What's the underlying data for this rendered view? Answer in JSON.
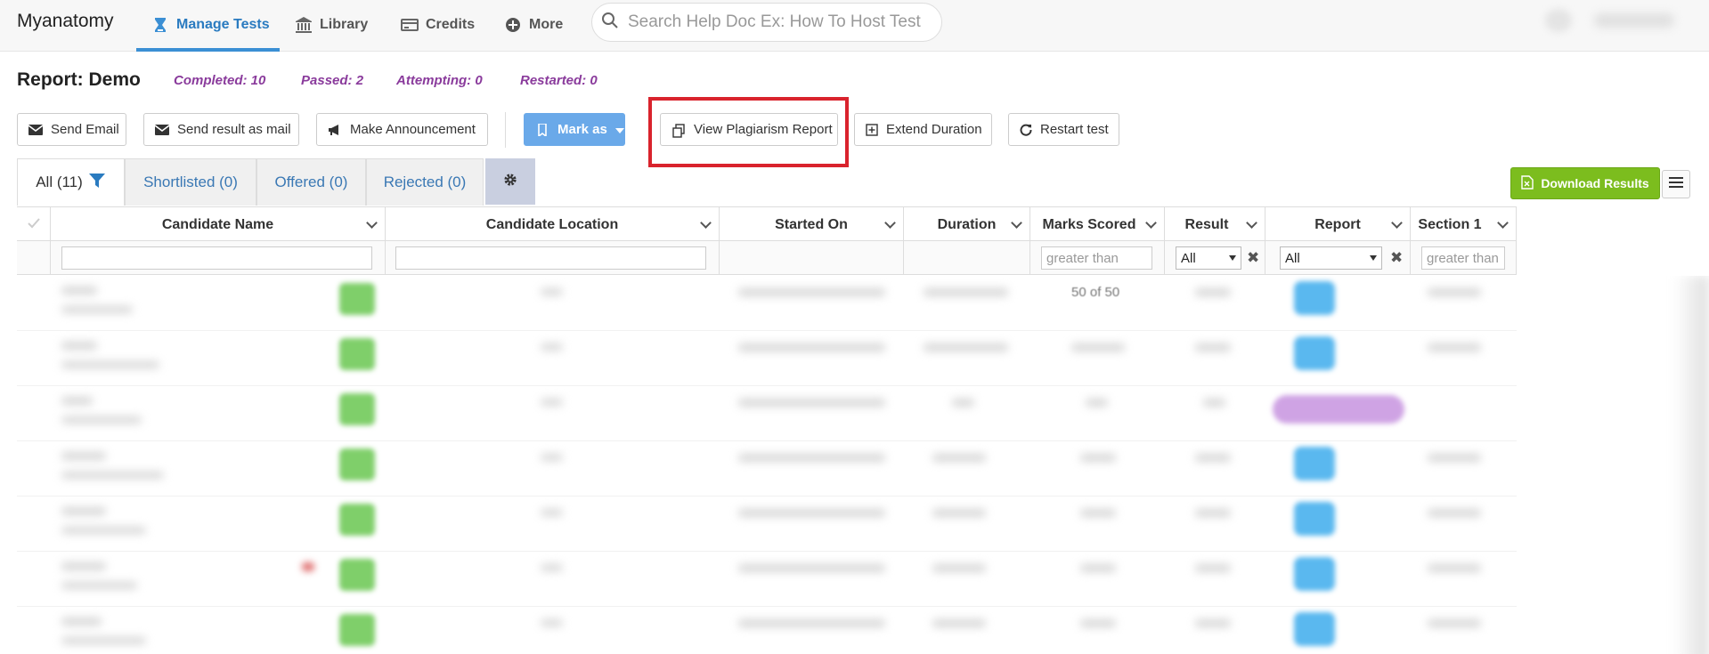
{
  "nav": {
    "brand": "Myanatomy",
    "items": [
      {
        "label": "Manage Tests",
        "icon": "hourglass-icon",
        "active": true
      },
      {
        "label": "Library",
        "icon": "bank-icon"
      },
      {
        "label": "Credits",
        "icon": "credit-card-icon"
      },
      {
        "label": "More",
        "icon": "plus-circle-icon"
      }
    ],
    "search_placeholder": "Search Help Doc Ex: How To Host Test"
  },
  "report": {
    "title": "Report: Demo",
    "stats": {
      "completed": "Completed: 10",
      "passed": "Passed: 2",
      "attempting": "Attempting: 0",
      "restarted": "Restarted: 0"
    }
  },
  "actions": {
    "send_email": "Send Email",
    "send_result": "Send result as mail",
    "announcement": "Make Announcement",
    "mark_as": "Mark as",
    "plagiarism": "View Plagiarism Report",
    "extend": "Extend Duration",
    "restart": "Restart test"
  },
  "tabs": [
    {
      "label": "All (11)",
      "active": true
    },
    {
      "label": "Shortlisted (0)"
    },
    {
      "label": "Offered (0)"
    },
    {
      "label": "Rejected (0)"
    }
  ],
  "download_label": "Download Results",
  "grid": {
    "columns": [
      "Candidate Name",
      "Candidate Location",
      "Started On",
      "Duration",
      "Marks Scored",
      "Result",
      "Report",
      "Section 1"
    ],
    "filters": {
      "marks_placeholder": "greater than",
      "result_value": "All",
      "report_value": "All",
      "section_placeholder": "greater than"
    },
    "first_row_marks": "50 of 50"
  },
  "colors": {
    "accent": "#3b8fd4",
    "stats": "#8a3b9c",
    "highlight": "#d9232d",
    "download": "#7cbd1e",
    "mark_as": "#6aa9e9"
  }
}
